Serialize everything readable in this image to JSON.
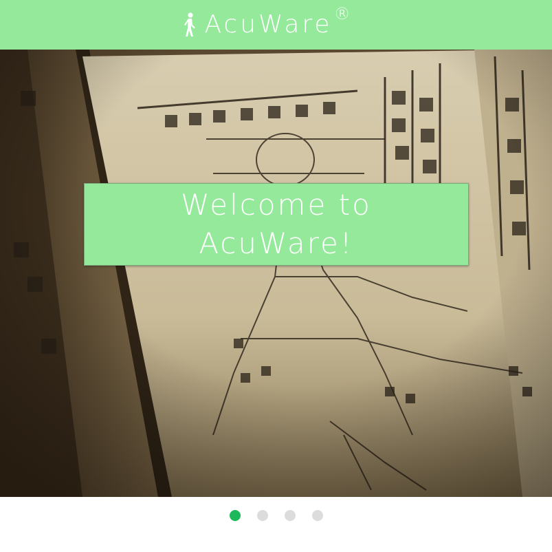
{
  "colors": {
    "header_bg": "#95e99b",
    "accent": "#95e99b",
    "dot_active": "#1cb85a",
    "dot_inactive": "#dcdcdc"
  },
  "header": {
    "icon": "walking-person-icon",
    "brand_name": "AcuWare",
    "registered_mark": "®"
  },
  "hero": {
    "image": "ancient-acupuncture-chart-image",
    "welcome_text": "Welcome to AcuWare!"
  },
  "carousel": {
    "total_slides": 4,
    "active_index": 0
  }
}
